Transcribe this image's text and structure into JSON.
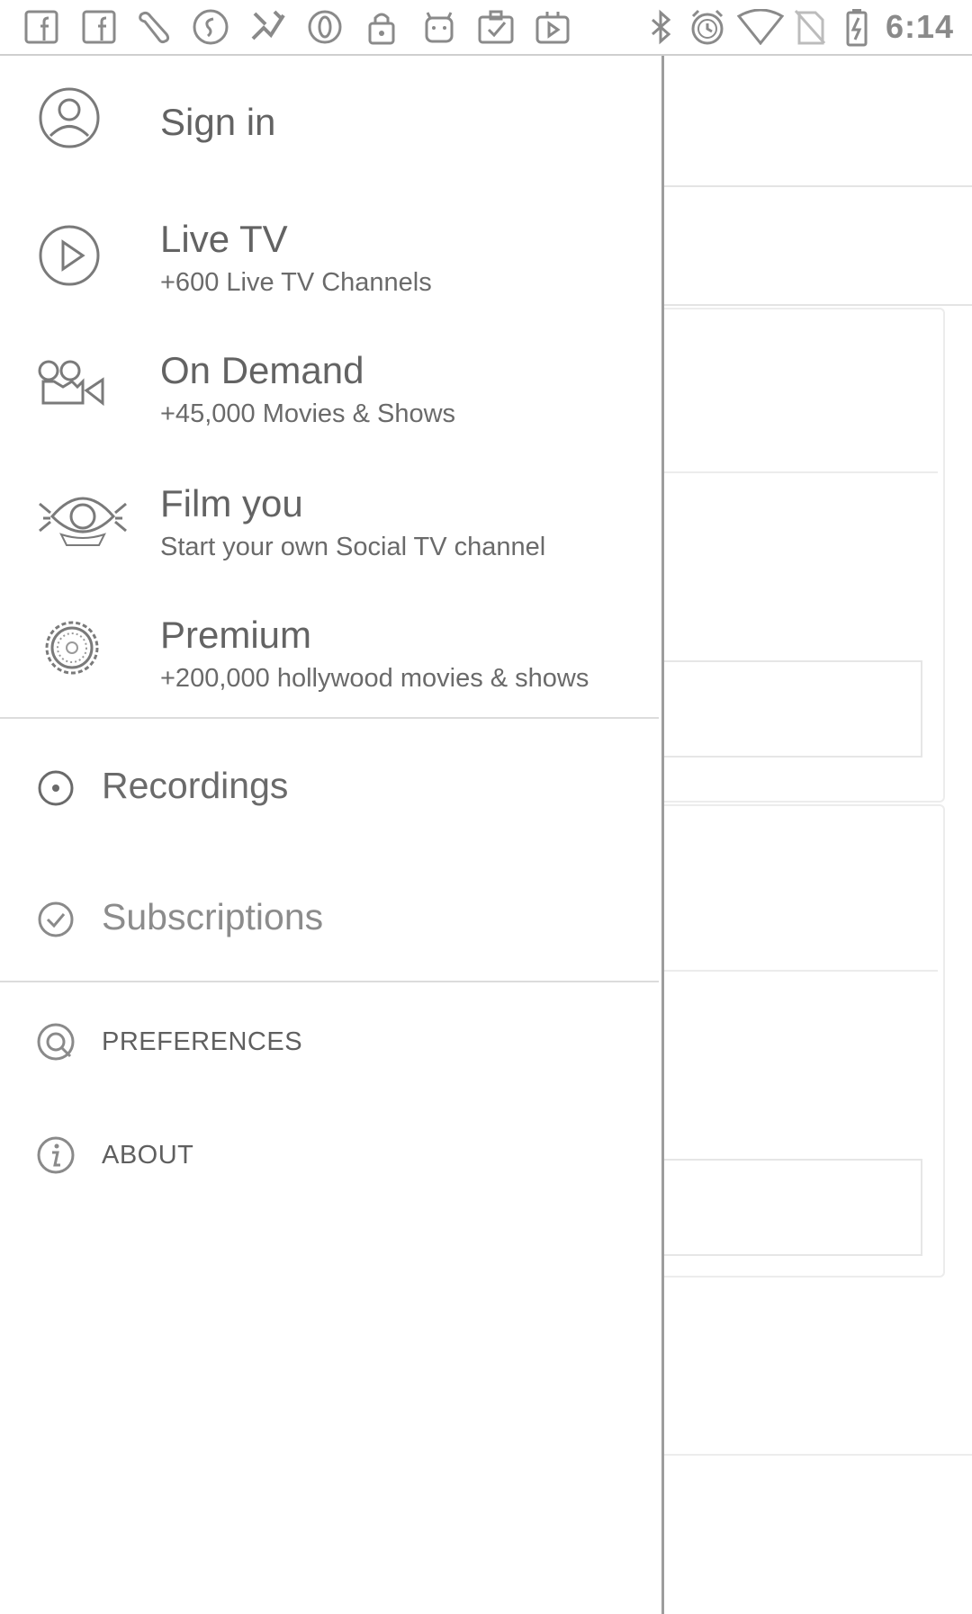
{
  "status_bar": {
    "left_icons": [
      "facebook-icon",
      "facebook-icon",
      "wrench-icon",
      "shazam-icon",
      "sports-icon",
      "opera-icon",
      "lock-icon",
      "android-icon",
      "clipboard-check-icon",
      "play-store-icon"
    ],
    "right_icons": [
      "bluetooth-icon",
      "alarm-icon",
      "wifi-icon",
      "no-sim-icon",
      "battery-charging-icon"
    ],
    "time": "6:14"
  },
  "drawer": {
    "sign_in": {
      "label": "Sign in",
      "icon": "user-icon"
    },
    "items": [
      {
        "title": "Live TV",
        "subtitle": "+600 Live TV Channels",
        "icon": "play-circle-icon"
      },
      {
        "title": "On Demand",
        "subtitle": "+45,000 Movies & Shows",
        "icon": "video-camera-icon"
      },
      {
        "title": "Film you",
        "subtitle": "Start your own Social TV channel",
        "icon": "eye-camera-icon"
      },
      {
        "title": "Premium",
        "subtitle": "+200,000 hollywood movies & shows",
        "icon": "premium-badge-icon"
      }
    ],
    "secondary": [
      {
        "title": "Recordings",
        "icon": "record-icon"
      },
      {
        "title": "Subscriptions",
        "icon": "check-circle-icon"
      }
    ],
    "footer": [
      {
        "title": "PREFERENCES",
        "icon": "preferences-icon"
      },
      {
        "title": "ABOUT",
        "icon": "info-icon"
      }
    ]
  },
  "colors": {
    "background": "#ffffff",
    "text": "#636363",
    "divider": "#dcdcdc",
    "drawer_edge": "#9d9d9d"
  }
}
